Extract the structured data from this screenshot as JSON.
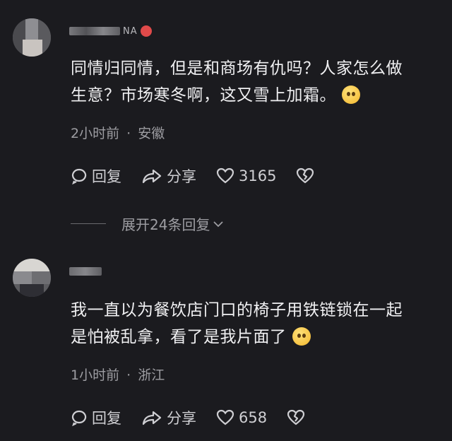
{
  "comments": [
    {
      "username_tag": "NA",
      "text_line1": "同情归同情，但是和商场有仇吗？人家怎么做",
      "text_line2": "生意？市场寒冬啊，这又雪上加霜。",
      "emoji": "pleading-face",
      "time": "2小时前",
      "location": "安徽",
      "reply_label": "回复",
      "share_label": "分享",
      "likes": "3165"
    },
    {
      "text_line1": "我一直以为餐饮店门口的椅子用铁链锁在一起",
      "text_line2": "是怕被乱拿，看了是我片面了",
      "emoji": "smiling-face",
      "time": "1小时前",
      "location": "浙江",
      "reply_label": "回复",
      "share_label": "分享",
      "likes": "658"
    }
  ],
  "expand_label": "展开24条回复",
  "separator": "·",
  "colors": {
    "background": "#1b1b1f",
    "text": "#f0f0f2",
    "meta": "#9d9da2"
  }
}
